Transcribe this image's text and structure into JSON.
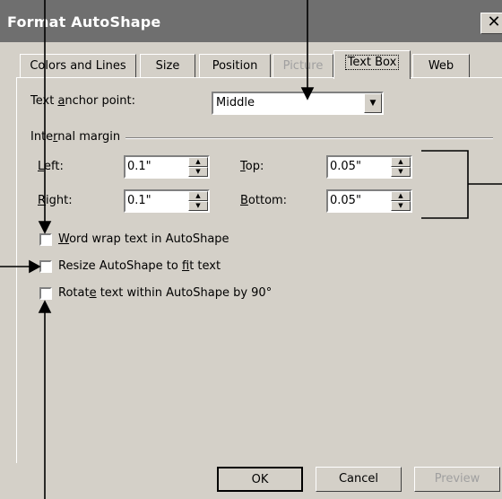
{
  "window": {
    "title": "Format AutoShape",
    "close_glyph": "✕"
  },
  "tabs": [
    {
      "label": "Colors and Lines",
      "state": "normal"
    },
    {
      "label": "Size",
      "state": "normal"
    },
    {
      "label": "Position",
      "state": "normal"
    },
    {
      "label": "Picture",
      "state": "disabled"
    },
    {
      "label": "Text Box",
      "state": "active"
    },
    {
      "label": "Web",
      "state": "normal"
    }
  ],
  "anchor": {
    "label_pre": "Text ",
    "label_key": "a",
    "label_post": "nchor point:",
    "value": "Middle"
  },
  "internal_margin": {
    "heading_pre": "Inte",
    "heading_key": "r",
    "heading_post": "nal margin",
    "left": {
      "label_key": "L",
      "label_post": "eft:",
      "value": "0.1\""
    },
    "right": {
      "label_key": "R",
      "label_post": "ight:",
      "value": "0.1\""
    },
    "top": {
      "label_key": "T",
      "label_post": "op:",
      "value": "0.05\""
    },
    "bottom": {
      "label_key": "B",
      "label_post": "ottom:",
      "value": "0.05\""
    }
  },
  "checkboxes": [
    {
      "pre": "",
      "key": "W",
      "post": "ord wrap text in AutoShape",
      "checked": false
    },
    {
      "pre": "Resize AutoShape to ",
      "key": "f",
      "post": "it text",
      "checked": false
    },
    {
      "pre": "Rotat",
      "key": "e",
      "post": " text within AutoShape by 90°",
      "checked": false
    }
  ],
  "buttons": {
    "ok": "OK",
    "cancel": "Cancel",
    "preview": "Preview"
  },
  "colors": {
    "titlebar": "#6f6f6f",
    "face": "#d4d0c8",
    "annotation": "#000000"
  }
}
